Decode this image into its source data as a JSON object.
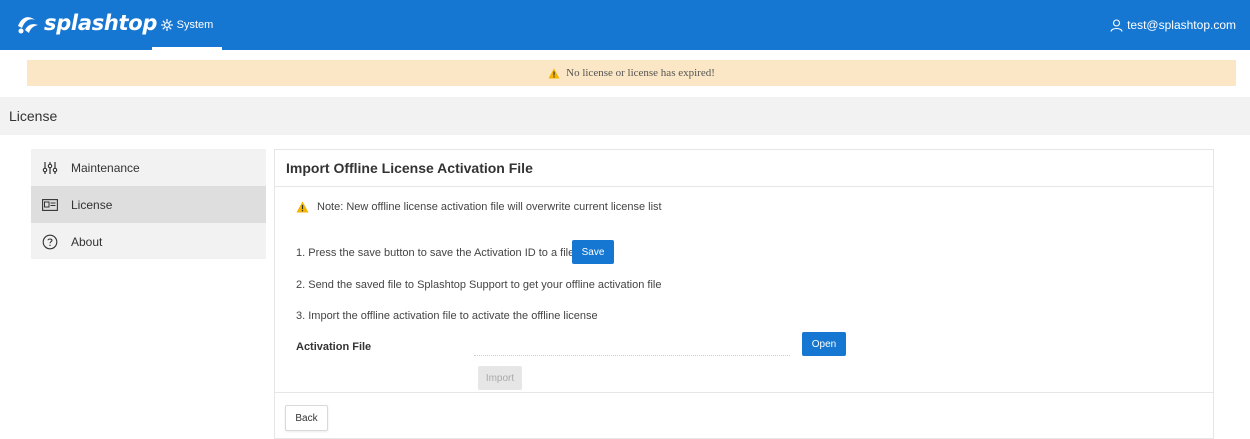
{
  "header": {
    "logo_text": "splashtop",
    "nav_tab_label": "System",
    "user_email": "test@splashtop.com"
  },
  "alert": {
    "message": "No license or license has expired!"
  },
  "page": {
    "title": "License"
  },
  "sidebar": {
    "items": [
      {
        "label": "Maintenance",
        "icon": "sliders-icon",
        "active": false
      },
      {
        "label": "License",
        "icon": "license-card-icon",
        "active": true
      },
      {
        "label": "About",
        "icon": "question-circle-icon",
        "active": false
      }
    ]
  },
  "panel": {
    "title": "Import Offline License Activation File",
    "note": "Note: New offline license activation file will overwrite current license list",
    "step1": "1. Press the save button to save the Activation ID to a file",
    "save_label": "Save",
    "step2": "2. Send the saved file to Splashtop Support to get your offline activation file",
    "step3": "3. Import the offline activation file to activate the offline license",
    "activation_file_label": "Activation File",
    "activation_file_value": "",
    "open_label": "Open",
    "import_label": "Import",
    "back_label": "Back"
  },
  "colors": {
    "brand_blue": "#1677d2",
    "alert_bg": "#fbe7c5",
    "warning_yellow": "#f5b400"
  }
}
